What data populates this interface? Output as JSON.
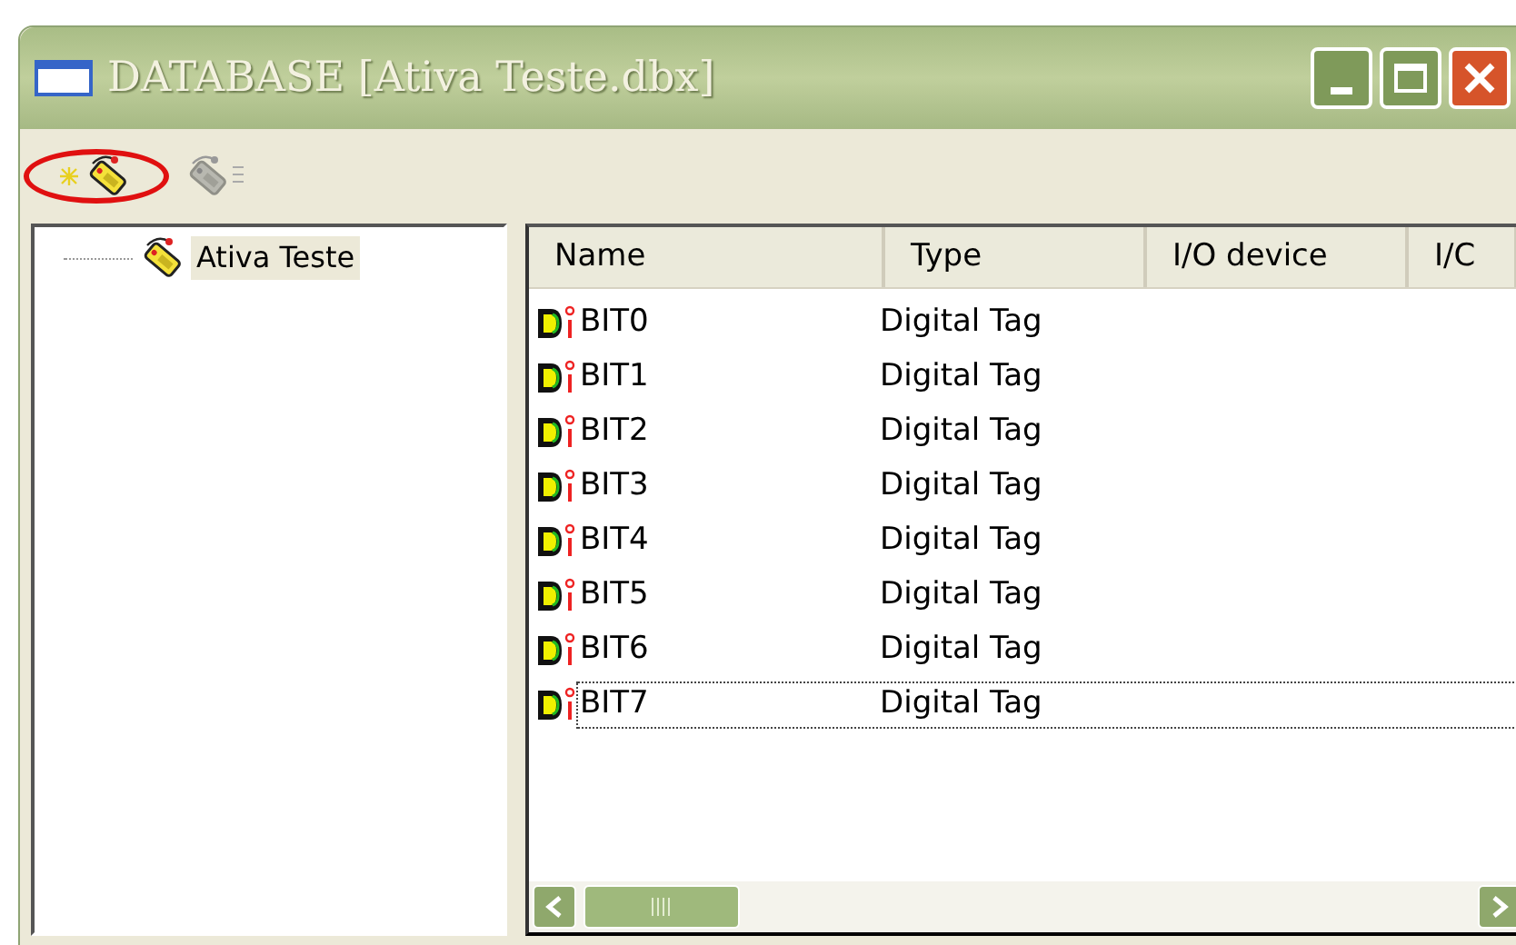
{
  "window": {
    "title": "DATABASE [Ativa Teste.dbx]"
  },
  "toolbar": [
    {
      "kind": "new-tag",
      "disabled": false,
      "highlighted": true
    },
    {
      "kind": "properties",
      "disabled": true,
      "highlighted": false
    }
  ],
  "tree": [
    {
      "label": "Ativa Teste",
      "selected": true
    }
  ],
  "table": {
    "columns": [
      "Name",
      "Type",
      "I/O device",
      "I/C"
    ],
    "rows": [
      {
        "name": "BIT0",
        "type": "Digital Tag",
        "focused": false
      },
      {
        "name": "BIT1",
        "type": "Digital Tag",
        "focused": false
      },
      {
        "name": "BIT2",
        "type": "Digital Tag",
        "focused": false
      },
      {
        "name": "BIT3",
        "type": "Digital Tag",
        "focused": false
      },
      {
        "name": "BIT4",
        "type": "Digital Tag",
        "focused": false
      },
      {
        "name": "BIT5",
        "type": "Digital Tag",
        "focused": false
      },
      {
        "name": "BIT6",
        "type": "Digital Tag",
        "focused": false
      },
      {
        "name": "BIT7",
        "type": "Digital Tag",
        "focused": true
      }
    ]
  }
}
